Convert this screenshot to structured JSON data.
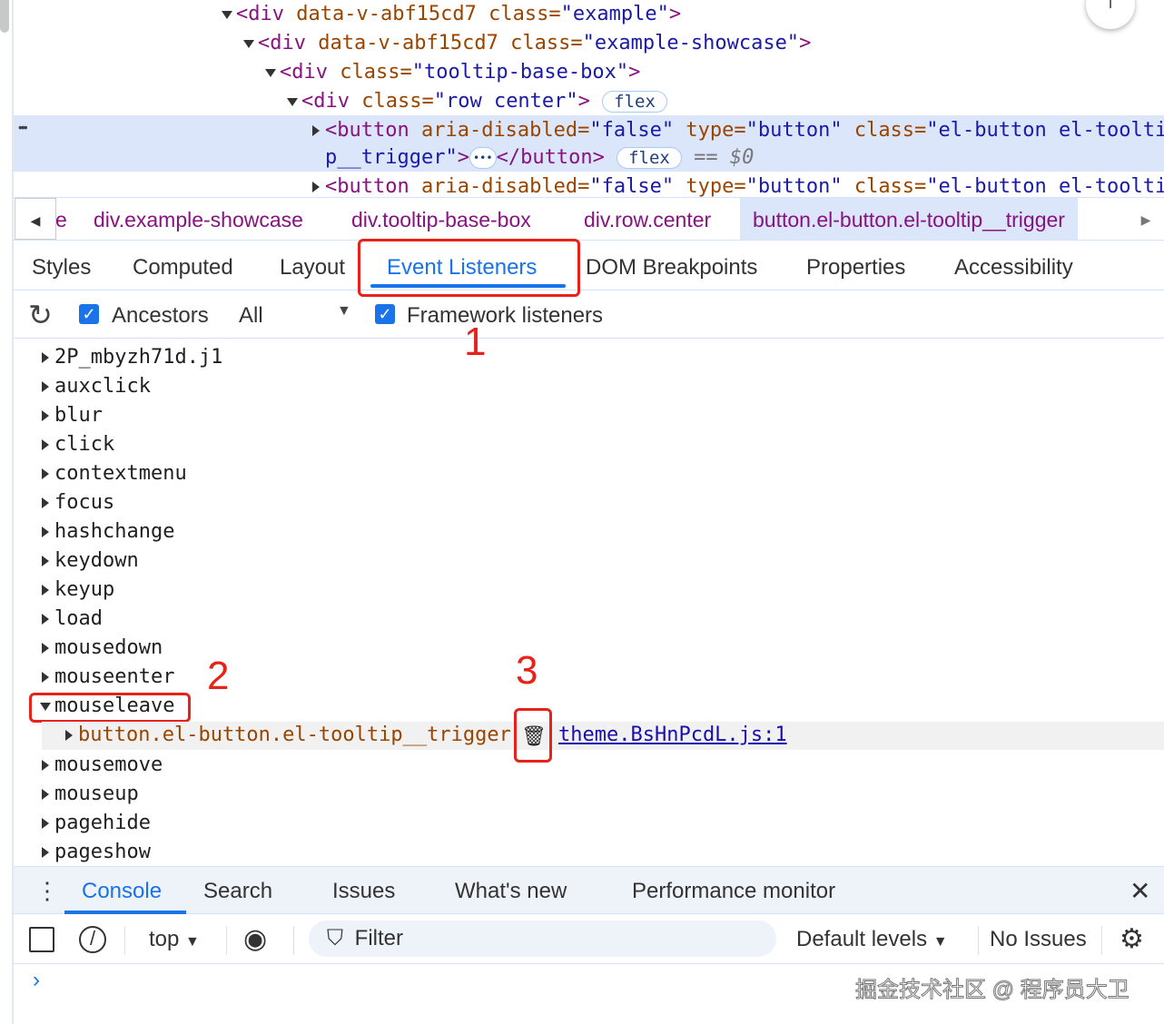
{
  "elements_tree": {
    "lines": [
      {
        "tag": "div",
        "attrs": [
          [
            "data-v-abf15cd7",
            null
          ],
          [
            "class",
            "example"
          ]
        ]
      },
      {
        "tag": "div",
        "attrs": [
          [
            "data-v-abf15cd7",
            null
          ],
          [
            "class",
            "example-showcase"
          ]
        ]
      },
      {
        "tag": "div",
        "attrs": [
          [
            "class",
            "tooltip-base-box"
          ]
        ]
      },
      {
        "tag": "div",
        "attrs": [
          [
            "class",
            "row center"
          ]
        ],
        "badge": "flex"
      }
    ],
    "l1": {
      "open": "<div ",
      "a1": "data-v-abf15cd7 ",
      "a2": "class=",
      "v2": "\"example\"",
      "close": ">"
    },
    "l2": {
      "open": "<div ",
      "a1": "data-v-abf15cd7 ",
      "a2": "class=",
      "v2": "\"example-showcase\"",
      "close": ">"
    },
    "l3": {
      "open": "<div ",
      "a2": "class=",
      "v2": "\"tooltip-base-box\"",
      "close": ">"
    },
    "l4": {
      "open": "<div ",
      "a2": "class=",
      "v2": "\"row center\"",
      "close": ">",
      "badge": "flex"
    },
    "selected": {
      "open": "<button ",
      "a1": "aria-disabled=",
      "v1": "\"false\"",
      "a2": " type=",
      "v2": "\"button\"",
      "a3": " class=",
      "v3": "\"el-button el-toolti",
      "v3b": "p__trigger\"",
      "close1": ">",
      "close2": "</button>",
      "badge": "flex",
      "eq": "== $0"
    },
    "next": {
      "open": "<button ",
      "a1": "aria-disabled=",
      "v1": "\"false\"",
      "a2": " type=",
      "v2": "\"button\"",
      "a3": " class=",
      "v3": "\"el-button el-toolti"
    },
    "dots": "•••"
  },
  "breadcrumbs": [
    "e",
    "div.example-showcase",
    "div.tooltip-base-box",
    "div.row.center",
    "button.el-button.el-tooltip__trigger"
  ],
  "panel_tabs": [
    "Styles",
    "Computed",
    "Layout",
    "Event Listeners",
    "DOM Breakpoints",
    "Properties",
    "Accessibility"
  ],
  "active_tab": "Event Listeners",
  "toolbar": {
    "ancestors": "Ancestors",
    "ancestors_checked": true,
    "filter_select": "All",
    "framework": "Framework listeners",
    "framework_checked": true
  },
  "events_before": [
    "2P_mbyzh71d.j1",
    "auxclick",
    "blur",
    "click",
    "contextmenu",
    "focus",
    "hashchange",
    "keydown",
    "keyup",
    "load",
    "mousedown",
    "mouseenter"
  ],
  "expanded_event": "mouseleave",
  "listener": {
    "node": "button.el-button.el-tooltip__trigger",
    "source": "theme.BsHnPcdL.js:1"
  },
  "events_after": [
    "mousemove",
    "mouseup",
    "pagehide",
    "pageshow"
  ],
  "annotations": [
    "1",
    "2",
    "3"
  ],
  "drawer_tabs": [
    "Console",
    "Search",
    "Issues",
    "What's new",
    "Performance monitor"
  ],
  "active_drawer_tab": "Console",
  "console_toolbar": {
    "context": "top",
    "filter_placeholder": "Filter",
    "levels": "Default levels",
    "issues": "No Issues"
  },
  "watermark": "掘金技术社区 @ 程序员大卫",
  "colors": {
    "accent": "#1a73e8",
    "annotation": "#e8221a",
    "selected_row": "#dbe6fb"
  }
}
